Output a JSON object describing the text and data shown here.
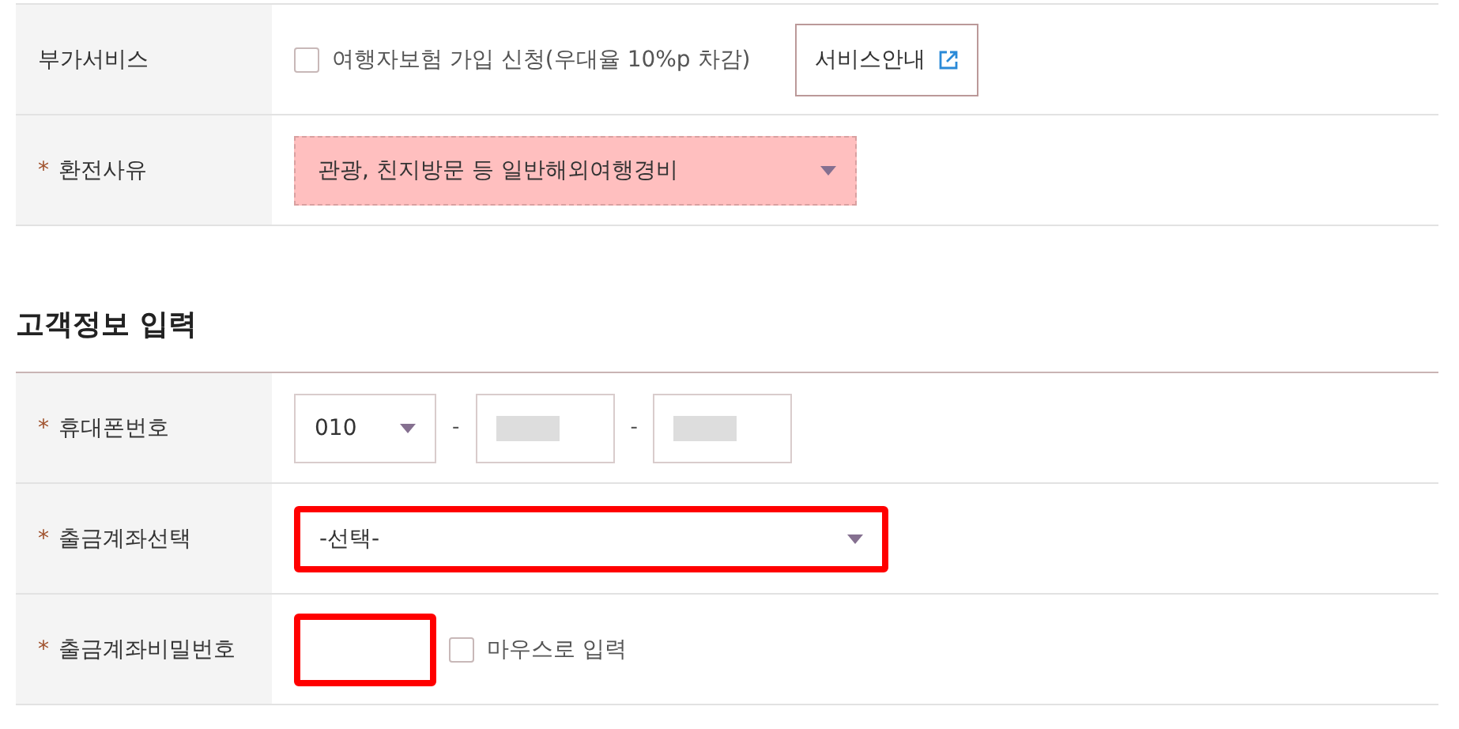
{
  "sections": [
    {
      "rows": [
        {
          "kind": "service",
          "label": "부가서비스",
          "checkbox": {
            "label": "여행자보험 가입 신청(우대율 10%p 차감)",
            "checked": false
          },
          "button": "서비스안내"
        },
        {
          "kind": "select",
          "mark": "*",
          "label": "환전사유",
          "value": "관광, 친지방문 등 일반해외여행경비",
          "error": true,
          "highlighted": false,
          "wide": false
        }
      ]
    },
    {
      "title": "고객정보 입력",
      "rows": [
        {
          "kind": "phone",
          "mark": "*",
          "label": "휴대폰번호",
          "prefix": "010",
          "separator": "-"
        },
        {
          "kind": "select",
          "mark": "*",
          "label": "출금계좌선택",
          "value": "-선택-",
          "error": false,
          "highlighted": true,
          "wide": true
        },
        {
          "kind": "password",
          "mark": "*",
          "label": "출금계좌비밀번호",
          "highlighted": true,
          "checkbox": {
            "label": "마우스로 입력",
            "checked": false
          }
        }
      ]
    }
  ]
}
